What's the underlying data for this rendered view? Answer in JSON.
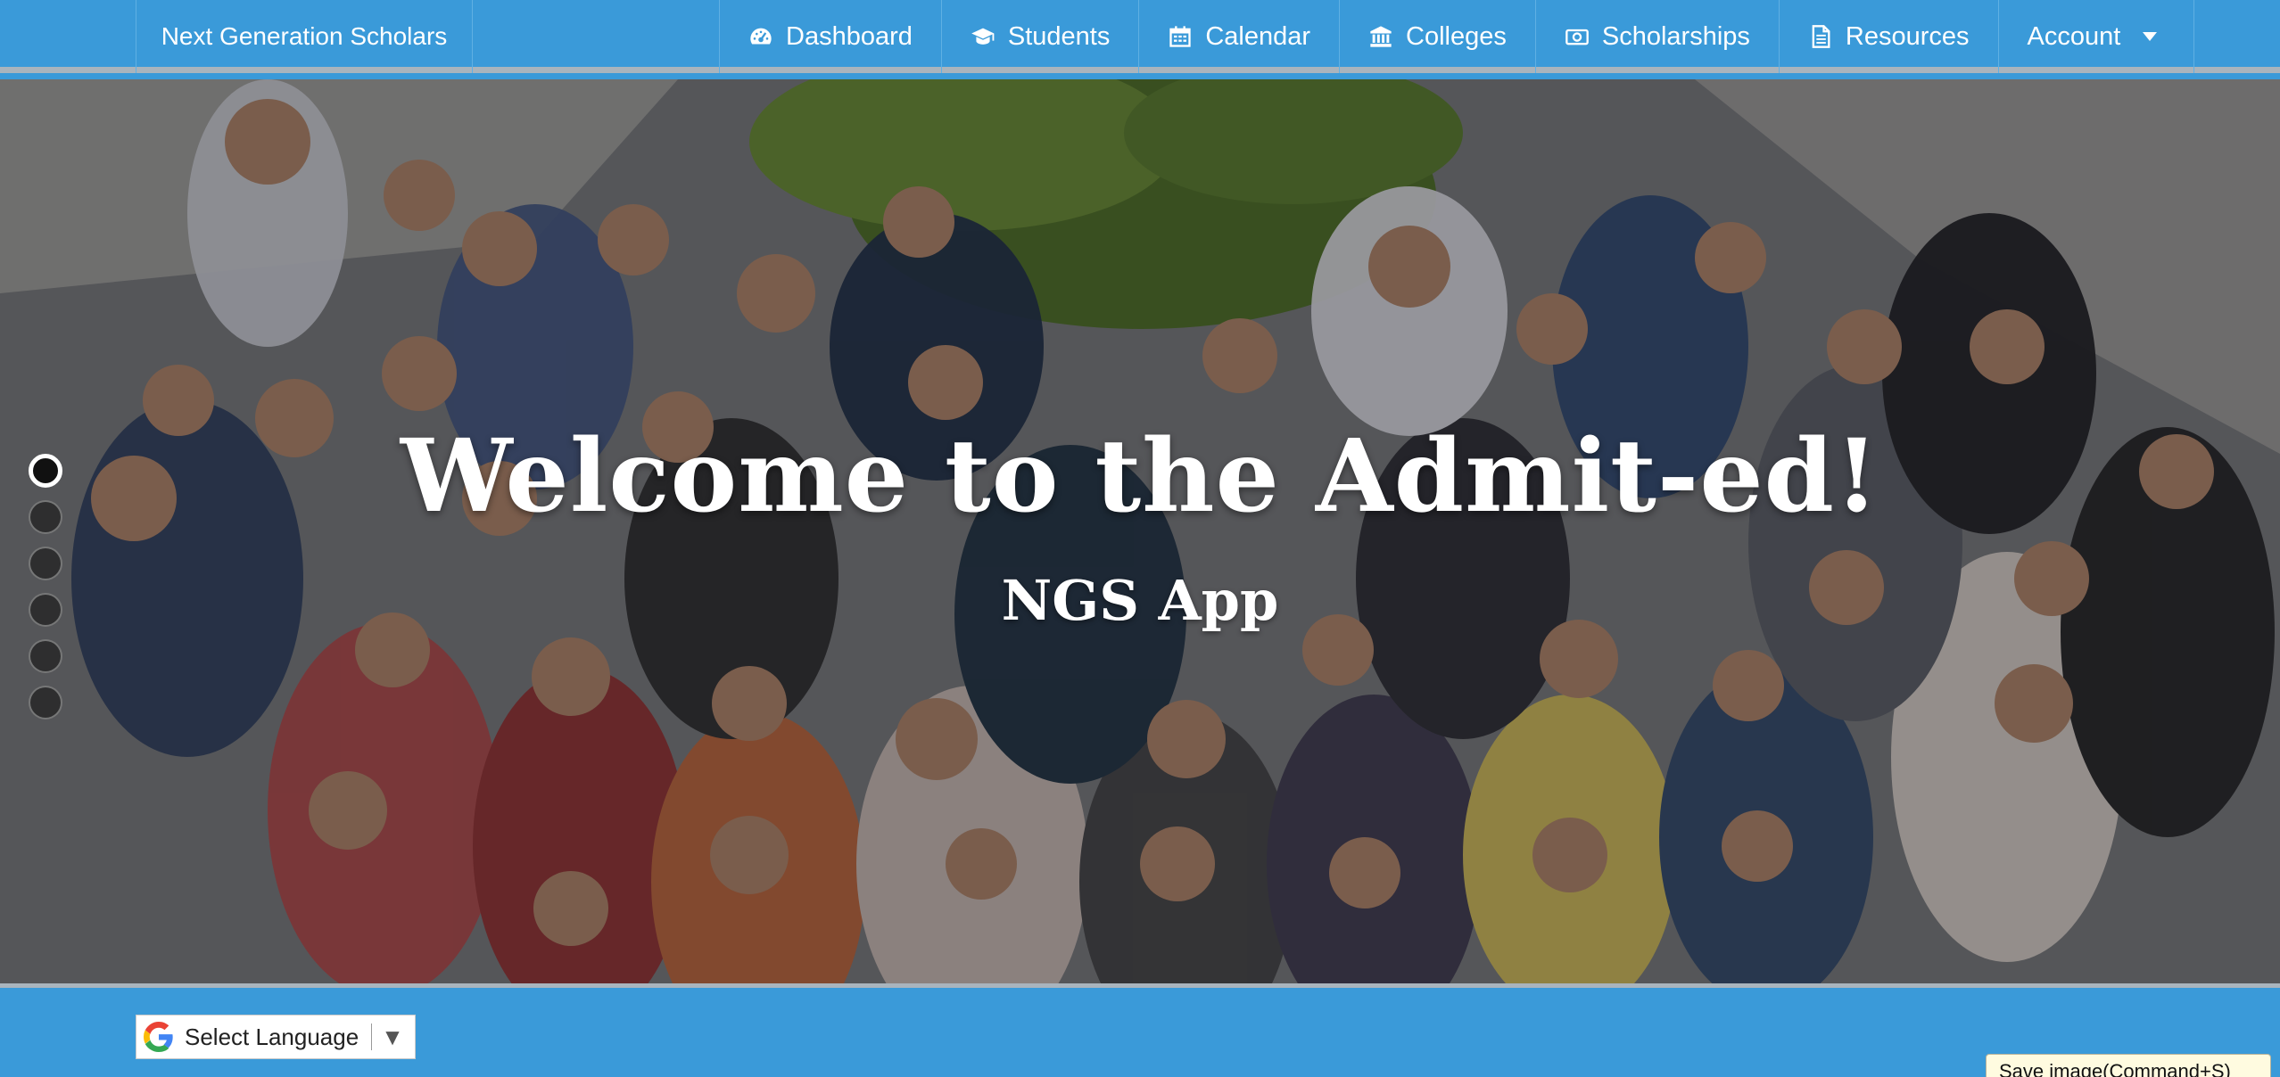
{
  "navbar": {
    "brand": "Next Generation Scholars",
    "items": [
      {
        "label": "Dashboard",
        "icon": "dashboard-gauge-icon"
      },
      {
        "label": "Students",
        "icon": "graduation-cap-icon"
      },
      {
        "label": "Calendar",
        "icon": "calendar-icon"
      },
      {
        "label": "Colleges",
        "icon": "institution-icon"
      },
      {
        "label": "Scholarships",
        "icon": "money-icon"
      },
      {
        "label": "Resources",
        "icon": "document-icon"
      },
      {
        "label": "Account",
        "icon": "caret-down-icon"
      }
    ]
  },
  "hero": {
    "title": "Welcome to the Admit-ed!",
    "subtitle": "NGS App",
    "slides": {
      "count": 6,
      "active_index": 0
    }
  },
  "footer": {
    "language_select": {
      "label": "Select Language",
      "arrow": "▼",
      "icon": "google-g-icon"
    }
  },
  "tooltip": {
    "text": "Save image(Command+S)"
  },
  "colors": {
    "nav_blue": "#3a9ad9",
    "divider_gray": "#a9b4bd"
  }
}
